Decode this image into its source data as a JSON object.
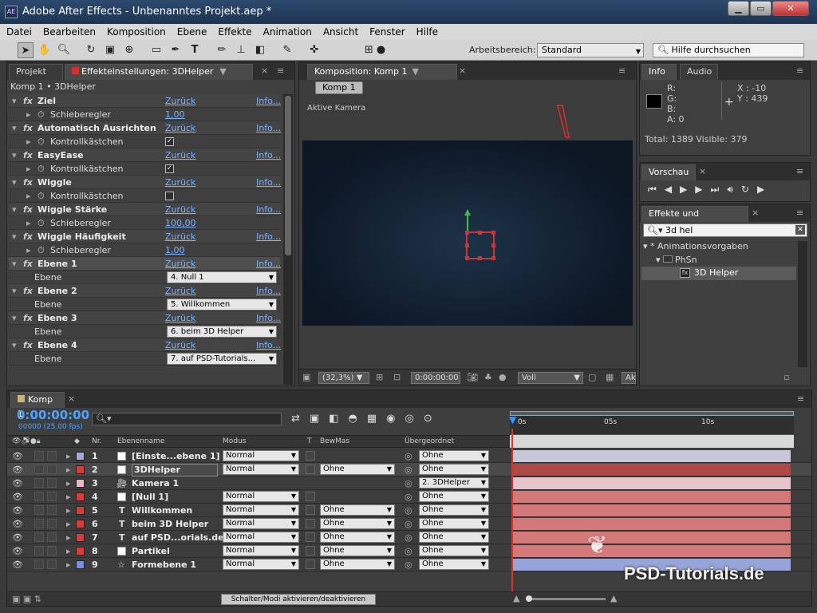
{
  "app": {
    "title": "Adobe After Effects - Unbenanntes Projekt.aep *",
    "icon": "AE"
  },
  "menu": [
    "Datei",
    "Bearbeiten",
    "Komposition",
    "Ebene",
    "Effekte",
    "Animation",
    "Ansicht",
    "Fenster",
    "Hilfe"
  ],
  "toolbar": {
    "workspace_label": "Arbeitsbereich:",
    "workspace_value": "Standard",
    "search_placeholder": "Hilfe durchsuchen"
  },
  "left": {
    "tab_project": "Projekt",
    "tab_effects": "Effekteinstellungen: 3DHelper",
    "subheader": "Komp 1 • 3DHelper",
    "rows": [
      {
        "kind": "fx",
        "label": "Ziel",
        "reset": "Zurück",
        "info": "Info..."
      },
      {
        "kind": "prop",
        "label": "Schieberegler",
        "value": "1,00",
        "type": "link"
      },
      {
        "kind": "fx",
        "label": "Automatisch Ausrichten",
        "reset": "Zurück",
        "info": "Info..."
      },
      {
        "kind": "prop",
        "label": "Kontrollkästchen",
        "value": "checked",
        "type": "check"
      },
      {
        "kind": "fx",
        "label": "EasyEase",
        "reset": "Zurück",
        "info": "Info..."
      },
      {
        "kind": "prop",
        "label": "Kontrollkästchen",
        "value": "checked",
        "type": "check"
      },
      {
        "kind": "fx",
        "label": "Wiggle",
        "reset": "Zurück",
        "info": "Info..."
      },
      {
        "kind": "prop",
        "label": "Kontrollkästchen",
        "value": "unchecked",
        "type": "check"
      },
      {
        "kind": "fx",
        "label": "Wiggle Stärke",
        "reset": "Zurück",
        "info": "Info..."
      },
      {
        "kind": "prop",
        "label": "Schieberegler",
        "value": "100,00",
        "type": "link"
      },
      {
        "kind": "fx",
        "label": "Wiggle Häufigkeit",
        "reset": "Zurück",
        "info": "Info..."
      },
      {
        "kind": "prop",
        "label": "Schieberegler",
        "value": "1,00",
        "type": "link"
      },
      {
        "kind": "fx",
        "label": "Ebene 1",
        "reset": "Zurück",
        "info": "Info..."
      },
      {
        "kind": "prop",
        "label": "Ebene",
        "value": "4. Null 1",
        "type": "select"
      },
      {
        "kind": "fx",
        "label": "Ebene 2",
        "reset": "Zurück",
        "info": "Info..."
      },
      {
        "kind": "prop",
        "label": "Ebene",
        "value": "5. Willkommen",
        "type": "select"
      },
      {
        "kind": "fx",
        "label": "Ebene 3",
        "reset": "Zurück",
        "info": "Info..."
      },
      {
        "kind": "prop",
        "label": "Ebene",
        "value": "6. beim 3D Helper",
        "type": "select"
      },
      {
        "kind": "fx",
        "label": "Ebene 4",
        "reset": "Zurück",
        "info": "Info..."
      },
      {
        "kind": "prop",
        "label": "Ebene",
        "value": "7. auf PSD-Tutorials...",
        "type": "select"
      }
    ]
  },
  "comp": {
    "tab": "Komposition: Komp 1",
    "sub_tab": "Komp 1",
    "camera_label": "Aktive Kamera",
    "zoom": "(32,3%)",
    "time": "0:00:00:00",
    "quality": "Voll",
    "cut": "Ak"
  },
  "info": {
    "tab": "Info",
    "tab2": "Audio",
    "r": "R:",
    "g": "G:",
    "b": "B:",
    "a": "A:  0",
    "x": "X : -10",
    "y": "Y : 439",
    "total": "Total: 1389  Visible: 379"
  },
  "preview": {
    "tab": "Vorschau"
  },
  "fxpresets": {
    "tab": "Effekte und Vorgaben",
    "search": "3d hel",
    "tree": [
      "* Animationsvorgaben",
      "PhSn",
      "3D Helper"
    ]
  },
  "timeline": {
    "tab": "Komp 1",
    "time": "0:00:00:00",
    "fps": "00000 (25.00 fps)",
    "headers": {
      "nr": "Nr.",
      "name": "Ebenenname",
      "modus": "Modus",
      "t": "T",
      "bewmas": "BewMas",
      "parent": "Übergeordnet"
    },
    "ruler": [
      "0s",
      "05s",
      "10s"
    ],
    "layers": [
      {
        "nr": "1",
        "name": "[Einste...ebene 1]",
        "modus": "Normal",
        "bewmas": "",
        "parent": "Ohne",
        "color": "#a8a8d8",
        "bar": "#c7c7d8",
        "icon": "white-square"
      },
      {
        "nr": "2",
        "name": "3DHelper",
        "modus": "Normal",
        "bewmas": "Ohne",
        "parent": "Ohne",
        "color": "#d04040",
        "bar": "#b04848",
        "icon": "white-square"
      },
      {
        "nr": "3",
        "name": "Kamera 1",
        "modus": "",
        "bewmas": "",
        "parent": "2. 3DHelper",
        "color": "#e8b8c8",
        "bar": "#e6c4cc",
        "icon": "camera"
      },
      {
        "nr": "4",
        "name": "[Null 1]",
        "modus": "Normal",
        "bewmas": "",
        "parent": "Ohne",
        "color": "#d04040",
        "bar": "#d47878",
        "icon": "white-square"
      },
      {
        "nr": "5",
        "name": "Willkommen",
        "modus": "Normal",
        "bewmas": "Ohne",
        "parent": "Ohne",
        "color": "#d04040",
        "bar": "#d47878",
        "icon": "text"
      },
      {
        "nr": "6",
        "name": "beim 3D Helper",
        "modus": "Normal",
        "bewmas": "Ohne",
        "parent": "Ohne",
        "color": "#d04040",
        "bar": "#d47878",
        "icon": "text"
      },
      {
        "nr": "7",
        "name": "auf PSD...orials.de",
        "modus": "Normal",
        "bewmas": "Ohne",
        "parent": "Ohne",
        "color": "#d04040",
        "bar": "#d47878",
        "icon": "text"
      },
      {
        "nr": "8",
        "name": "Partikel",
        "modus": "Normal",
        "bewmas": "Ohne",
        "parent": "Ohne",
        "color": "#d04040",
        "bar": "#d47878",
        "icon": "white-square"
      },
      {
        "nr": "9",
        "name": "Formebene 1",
        "modus": "Normal",
        "bewmas": "Ohne",
        "parent": "Ohne",
        "color": "#7a8ee0",
        "bar": "#98a4d8",
        "icon": "star"
      }
    ],
    "footer_button": "Schalter/Modi aktivieren/deaktivieren"
  },
  "watermark": "PSD-Tutorials.de"
}
